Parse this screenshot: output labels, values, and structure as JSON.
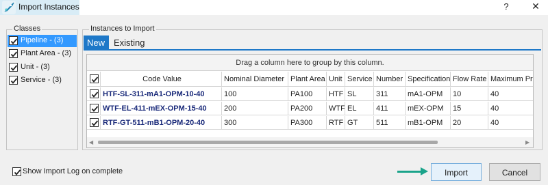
{
  "window": {
    "title": "Import Instances",
    "help_glyph": "?",
    "close_glyph": "✕"
  },
  "classes": {
    "title": "Classes",
    "items": [
      {
        "label": "Pipeline - (3)",
        "checked": true,
        "selected": true
      },
      {
        "label": "Plant Area - (3)",
        "checked": true,
        "selected": false
      },
      {
        "label": "Unit - (3)",
        "checked": true,
        "selected": false
      },
      {
        "label": "Service - (3)",
        "checked": true,
        "selected": false
      }
    ]
  },
  "instances": {
    "title": "Instances to Import",
    "tabs": [
      {
        "label": "New",
        "active": true
      },
      {
        "label": "Existing",
        "active": false
      }
    ],
    "group_hint": "Drag a column here to group by this column.",
    "columns": [
      "Code Value",
      "Nominal Diameter",
      "Plant Area",
      "Unit",
      "Service",
      "Number",
      "Specification",
      "Flow Rate",
      "Maximum Press"
    ],
    "rows": [
      {
        "checked": true,
        "cells": [
          "HTF-SL-311-mA1-OPM-10-40",
          "100",
          "PA100",
          "HTF",
          "SL",
          "311",
          "mA1-OPM",
          "10",
          "40"
        ]
      },
      {
        "checked": true,
        "cells": [
          "WTF-EL-411-mEX-OPM-15-40",
          "200",
          "PA200",
          "WTF",
          "EL",
          "411",
          "mEX-OPM",
          "15",
          "40"
        ]
      },
      {
        "checked": true,
        "cells": [
          "RTF-GT-511-mB1-OPM-20-40",
          "300",
          "PA300",
          "RTF",
          "GT",
          "511",
          "mB1-OPM",
          "20",
          "40"
        ]
      }
    ]
  },
  "footer": {
    "show_log_label": "Show Import Log on complete",
    "show_log_checked": true,
    "import_label": "Import",
    "cancel_label": "Cancel"
  },
  "colors": {
    "accent": "#1e78c8",
    "selection": "#3399ff",
    "arrow": "#1aa38a",
    "code_text": "#1a2a7a"
  }
}
